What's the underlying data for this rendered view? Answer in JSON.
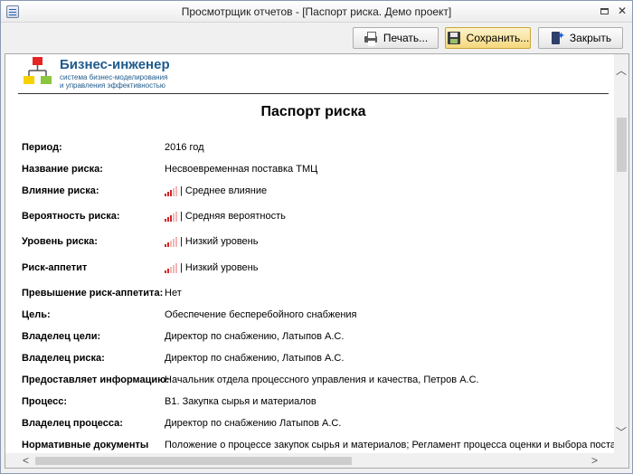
{
  "window": {
    "title": "Просмотрщик отчетов -  [Паспорт риска. Демо проект]"
  },
  "toolbar": {
    "print_label": "Печать...",
    "save_label": "Сохранить...",
    "close_label": "Закрыть"
  },
  "logo": {
    "title": "Бизнес-инженер",
    "subtitle_line1": "система бизнес-моделирования",
    "subtitle_line2": "и управления эффективностью",
    "colors": {
      "red": "#e52521",
      "yellow": "#f5d300",
      "green": "#8cc63f",
      "line": "#555555"
    }
  },
  "report": {
    "title": "Паспорт риска",
    "fields": [
      {
        "label": "Период:",
        "value": "2016 год"
      },
      {
        "label": "Название риска:",
        "value": "Несвоевременная поставка ТМЦ"
      },
      {
        "label": "Влияние риска:",
        "value": "| Среднее влияние",
        "signal_level": 3
      },
      {
        "label": "Вероятность риска:",
        "value": "| Средняя вероятность",
        "signal_level": 3
      },
      {
        "label": "Уровень риска:",
        "value": "| Низкий уровень",
        "signal_level": 2
      },
      {
        "label": "Риск-аппетит",
        "value": "| Низкий уровень",
        "signal_level": 2
      },
      {
        "label": "Превышение риск-аппетита:",
        "value": "Нет"
      },
      {
        "label": "Цель:",
        "value": "Обеспечение бесперебойного снабжения"
      },
      {
        "label": "Владелец цели:",
        "value": "Директор по снабжению, Латыпов А.С."
      },
      {
        "label": "Владелец риска:",
        "value": "Директор по снабжению, Латыпов А.С."
      },
      {
        "label": "Предоставляет информацию:",
        "value": "Начальник отдела процессного управления и качества, Петров А.С."
      },
      {
        "label": "Процесс:",
        "value": "В1. Закупка сырья и материалов"
      },
      {
        "label": "Владелец процесса:",
        "value": "Директор по снабжению Латыпов А.С."
      },
      {
        "label": "Нормативные документы",
        "value": "Положение о процессе закупок сырья и материалов; Регламент процесса оценки и выбора поставщика"
      }
    ]
  },
  "signal": {
    "total_bars": 5,
    "on_color": "#d32424",
    "off_color": "#f2b7b7"
  }
}
